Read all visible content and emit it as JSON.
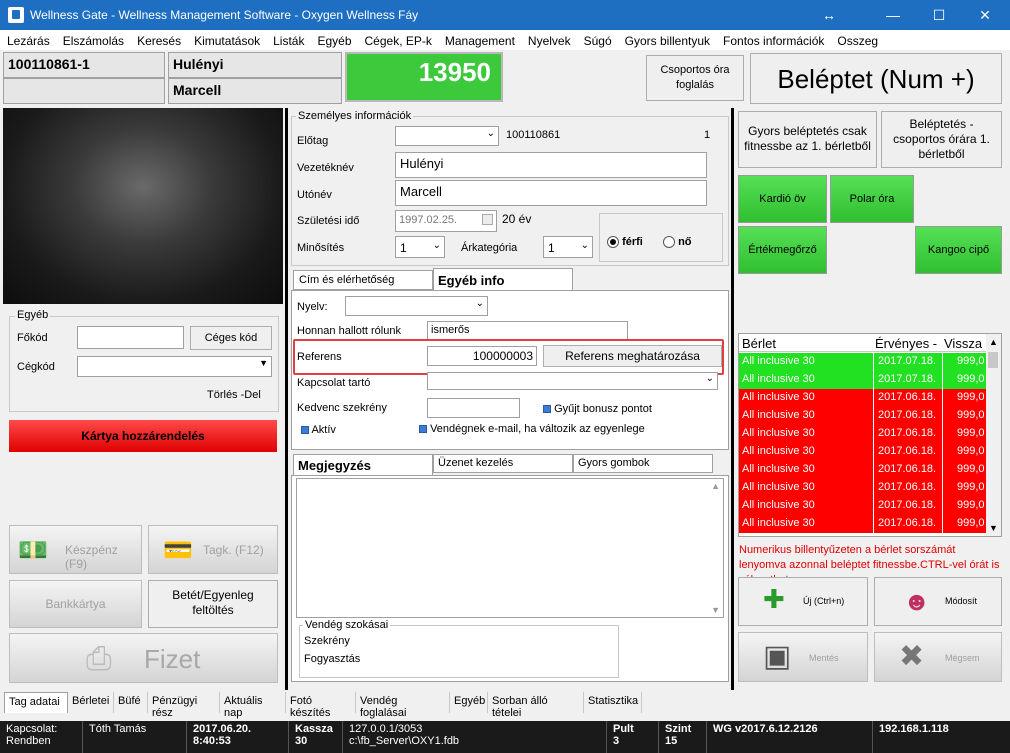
{
  "window": {
    "title": "Wellness Gate - Wellness Management Software - Oxygen Wellness Fáy",
    "controls": {
      "restore_glyph": "↔",
      "minimize": "—",
      "maximize": "☐",
      "close": "✕"
    }
  },
  "menu": [
    "Lezárás",
    "Elszámolás",
    "Keresés",
    "Kimutatások",
    "Listák",
    "Egyéb",
    "Cégek, EP-k",
    "Management",
    "Nyelvek",
    "Súgó",
    "Gyors billentyuk",
    "Fontos információk",
    "Osszeg"
  ],
  "member": {
    "id": "100110861-1",
    "last_name": "Hulényi",
    "first_name": "Marcell",
    "balance": "13950"
  },
  "top_buttons": {
    "group_booking": "Csoportos óra foglalás",
    "checkin": "Beléptet (Num +)"
  },
  "left_panel": {
    "egyeb_legend": "Egyéb",
    "fokod_label": "Főkód",
    "fokod_value": "",
    "ceges_kod_button": "Céges kód",
    "cegkod_label": "Cégkód",
    "cegkod_value": "",
    "torles": "Törlés -Del",
    "card_assign": "Kártya hozzárendelés",
    "cash": "Készpénz (F9)",
    "tagk": "Tagk. (F12)",
    "bankcard": "Bankkártya",
    "deposit": "Betét/Egyenleg feltöltés",
    "pay": "Fizet"
  },
  "personal": {
    "legend": "Személyes információk",
    "elotag_label": "Előtag",
    "elotag_value": "",
    "id_value": "100110861",
    "count": "1",
    "vezeteknev_label": "Vezetéknév",
    "vezeteknev": "Hulényi",
    "utonev_label": "Utónév",
    "utonev": "Marcell",
    "szuletesi_label": "Születési idő",
    "szuletesi": "1997.02.25.",
    "age": "20 év",
    "minosites_label": "Minősítés",
    "minosites": "1",
    "arkategoria_label": "Árkategória",
    "arkategoria": "1",
    "ferfi": "férfi",
    "no": "nő"
  },
  "info_tabs": {
    "tab1": "Cím és elérhetőség",
    "tab2": "Egyéb info"
  },
  "other_info": {
    "nyelv_label": "Nyelv:",
    "nyelv_value": "",
    "honnan_label": "Honnan hallott rólunk",
    "honnan_value": "ismerős",
    "referens_label": "Referens",
    "referens_value": "100000003",
    "referens_button": "Referens meghatározása",
    "kapcsolat_label": "Kapcsolat tartó",
    "kapcsolat_value": "",
    "kedvenc_label": "Kedvenc szekrény",
    "kedvenc_value": "",
    "bonus": "Gyűjt bonusz pontot",
    "aktiv": "Aktív",
    "email_notify": "Vendégnek e-mail, ha változik az egyenlege"
  },
  "note_tabs": {
    "tab1": "Megjegyzés",
    "tab2": "Üzenet kezelés",
    "tab3": "Gyors gombok"
  },
  "habits": {
    "legend": "Vendég szokásai",
    "item1": "Szekrény",
    "item2": "Fogyasztás"
  },
  "right_panel": {
    "fast_fitness": "Gyors beléptetés csak fitnessbe az 1. bérletből",
    "fast_group": "Beléptetés - csoportos órára 1. bérletből",
    "kardio": "Kardió öv",
    "polar": "Polar óra",
    "ertekmegorzo": "Értékmegőrző",
    "kangoo": "Kangoo cipő",
    "table_headers": [
      "Bérlet",
      "Érvényes -",
      "Vissza"
    ],
    "passes": [
      {
        "name": "All inclusive 30",
        "valid": "2017.07.18.",
        "remaining": "999,0",
        "status": "green"
      },
      {
        "name": "All inclusive 30",
        "valid": "2017.07.18.",
        "remaining": "999,0",
        "status": "green"
      },
      {
        "name": "All inclusive 30",
        "valid": "2017.06.18.",
        "remaining": "999,0",
        "status": "red"
      },
      {
        "name": "All inclusive 30",
        "valid": "2017.06.18.",
        "remaining": "999,0",
        "status": "red"
      },
      {
        "name": "All inclusive 30",
        "valid": "2017.06.18.",
        "remaining": "999,0",
        "status": "red"
      },
      {
        "name": "All inclusive 30",
        "valid": "2017.06.18.",
        "remaining": "999,0",
        "status": "red"
      },
      {
        "name": "All inclusive 30",
        "valid": "2017.06.18.",
        "remaining": "999,0",
        "status": "red"
      },
      {
        "name": "All inclusive 30",
        "valid": "2017.06.18.",
        "remaining": "999,0",
        "status": "red"
      },
      {
        "name": "All inclusive 30",
        "valid": "2017.06.18.",
        "remaining": "999,0",
        "status": "red"
      },
      {
        "name": "All inclusive 30",
        "valid": "2017.06.18.",
        "remaining": "999,0",
        "status": "red"
      }
    ],
    "hint": "Numerikus billentyűzeten a bérlet sorszámát lenyomva azonnal beléptet fitnessbe.CTRL-vel órát is választhat",
    "new_button": "Új (Ctrl+n)",
    "edit_button": "Módosít",
    "save_button": "Mentés",
    "cancel_button": "Mégsem"
  },
  "bottom_tabs": [
    "Tag adatai",
    "Bérletei",
    "Büfé",
    "Pénzügyi rész",
    "Aktuális nap",
    "Fotó készítés",
    "Vendég foglalásai",
    "Egyéb",
    "Sorban álló tételei",
    "Statisztika"
  ],
  "status": {
    "kapcsolat_label": "Kapcsolat:",
    "kapcsolat_value": "Rendben",
    "user": "Tóth Tamás",
    "date": "2017.06.20.",
    "time": "8:40:53",
    "kassza_label": "Kassza",
    "kassza_value": "30",
    "server": "127.0.0.1/3053",
    "db": "c:\\fb_Server\\OXY1.fdb",
    "pult_label": "Pult",
    "pult_value": "3",
    "szint_label": "Szint",
    "szint_value": "15",
    "version": "WG v2017.6.12.2126",
    "ip": "192.168.1.118"
  },
  "colors": {
    "titlebar": "#1e6fc2",
    "balance_green": "#3cc93c",
    "pass_green": "#22e022",
    "pass_red": "#ff0000",
    "highlight": "#e04040"
  }
}
